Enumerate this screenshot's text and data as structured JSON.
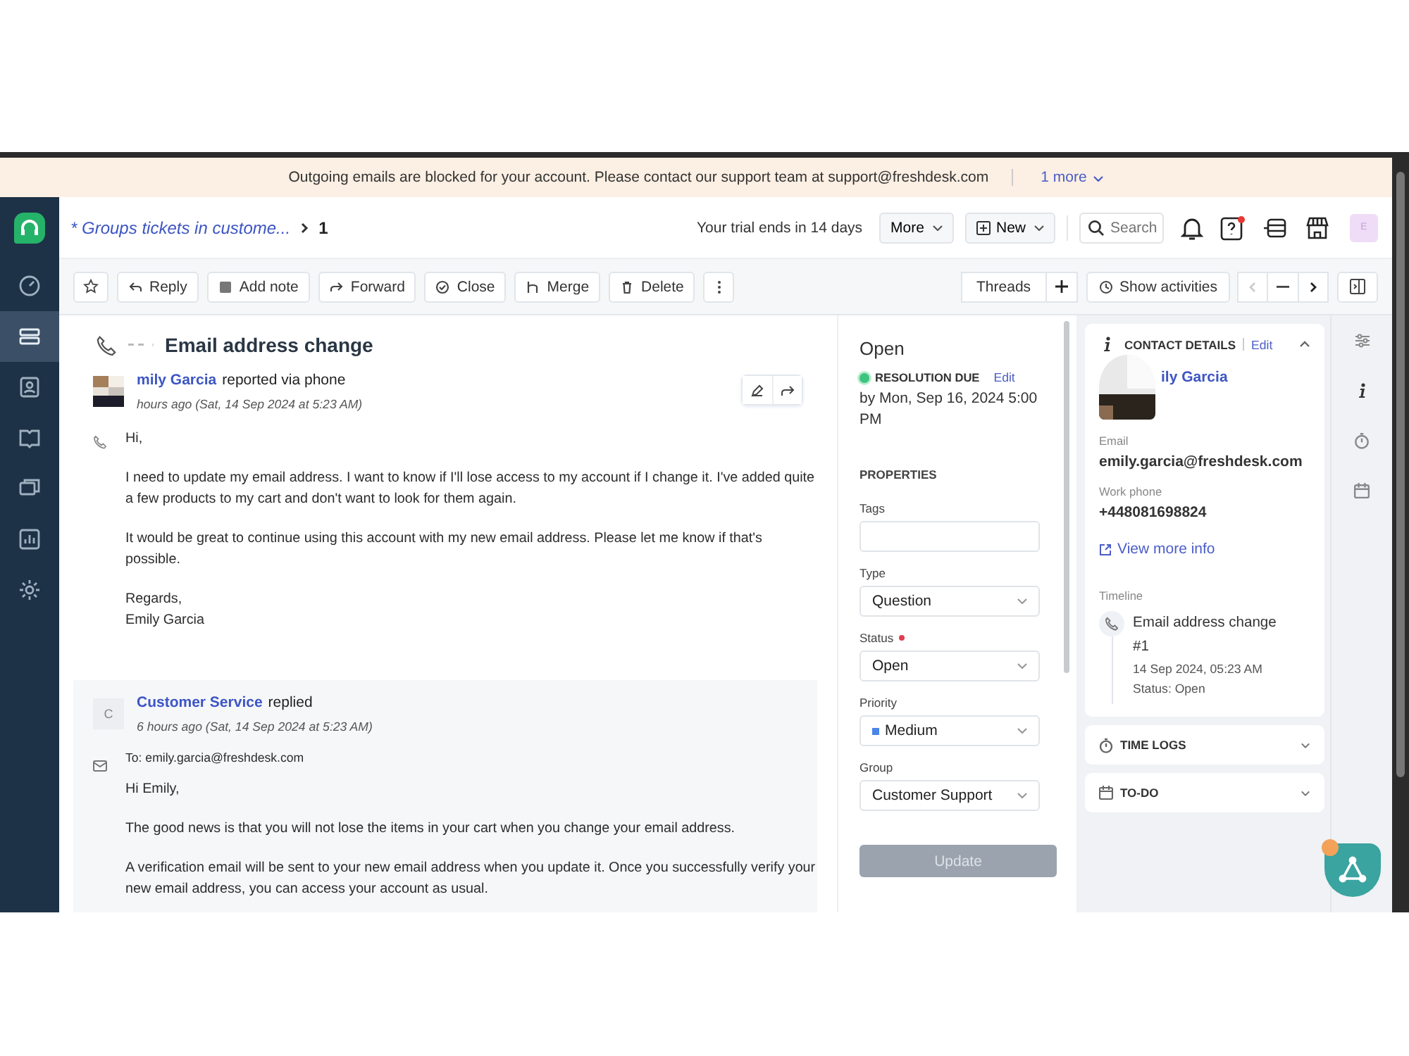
{
  "banner": {
    "message": "Outgoing emails are blocked for your account. Please contact our support team at support@freshdesk.com",
    "more": "1 more"
  },
  "sidebar": {
    "items": [
      {
        "kind": "dashboard",
        "selected": false
      },
      {
        "kind": "tickets",
        "selected": true
      },
      {
        "kind": "contacts",
        "selected": false
      },
      {
        "kind": "book",
        "selected": false
      },
      {
        "kind": "chat",
        "selected": false
      },
      {
        "kind": "reports",
        "selected": false
      },
      {
        "kind": "settings",
        "selected": false
      }
    ]
  },
  "header": {
    "breadcrumb": "* Groups tickets in custome...",
    "ticket_number": "1",
    "trial": "Your trial ends in 14 days",
    "more_button": "More",
    "new_button": "New",
    "search": {
      "placeholder": "Search"
    },
    "avatar_initial": "E"
  },
  "toolbar": {
    "actions": [
      {
        "kind": "reply",
        "label": "Reply"
      },
      {
        "kind": "note",
        "label": "Add note"
      },
      {
        "kind": "forward",
        "label": "Forward"
      },
      {
        "kind": "close",
        "label": "Close"
      },
      {
        "kind": "merge",
        "label": "Merge"
      },
      {
        "kind": "delete",
        "label": "Delete"
      }
    ],
    "threads": "Threads",
    "show_activities": "Show activities"
  },
  "ticket": {
    "title": "Email address change",
    "messages": [
      {
        "kind": "incoming",
        "author": "mily Garcia",
        "action": "reported via phone",
        "time": "hours ago (Sat, 14 Sep 2024 at 5:23 AM)",
        "paragraphs": [
          "Hi,",
          "I need to update my email address. I want to know if I'll lose access to my account if I change it. I've added quite a few products to my cart and don't want to look for them again.",
          "It would be great to continue using this account with my new email address. Please let me know if that's possible.",
          "Regards,\nEmily Garcia"
        ]
      },
      {
        "kind": "reply",
        "author": "Customer Service",
        "avatar_initial": "C",
        "action": "replied",
        "time": "6 hours ago (Sat, 14 Sep 2024 at 5:23 AM)",
        "to": "To: emily.garcia@freshdesk.com",
        "paragraphs": [
          "Hi Emily,",
          "The good news is that you will not lose the items in your cart when you change your email address.",
          "A verification email will be sent to your new email address when you update it. Once you successfully verify your new email address, you can access your account as usual."
        ]
      }
    ]
  },
  "properties": {
    "status": "Open",
    "sla": {
      "label": "RESOLUTION DUE",
      "edit": "Edit",
      "due": "by Mon, Sep 16, 2024 5:00 PM"
    },
    "heading": "PROPERTIES",
    "fields": [
      {
        "kind": "text",
        "label": "Tags",
        "required": false
      },
      {
        "kind": "select",
        "label": "Type",
        "value": "Question",
        "required": false
      },
      {
        "kind": "select",
        "label": "Status",
        "value": "Open",
        "required": true
      },
      {
        "kind": "select",
        "label": "Priority",
        "value": "Medium",
        "color": "#4a86e8",
        "required": false
      },
      {
        "kind": "select",
        "label": "Group",
        "value": "Customer Support",
        "required": false
      }
    ],
    "update_button": {
      "label": "Update",
      "disabled": true
    }
  },
  "contact": {
    "heading": "CONTACT DETAILS",
    "edit": "Edit",
    "expanded": true,
    "name": "ily Garcia",
    "fields": [
      {
        "label": "Email",
        "value": "emily.garcia@freshdesk.com"
      },
      {
        "label": "Work phone",
        "value": "+448081698824"
      }
    ],
    "link": "View more info",
    "timeline_label": "Timeline",
    "timeline": [
      {
        "title": "Email address change",
        "number": "#1",
        "time": "14 Sep 2024, 05:23 AM",
        "status": "Status: Open"
      }
    ]
  },
  "sections": [
    {
      "kind": "timelogs",
      "label": "TIME LOGS",
      "expanded": false
    },
    {
      "kind": "todo",
      "label": "TO-DO",
      "expanded": false
    }
  ]
}
